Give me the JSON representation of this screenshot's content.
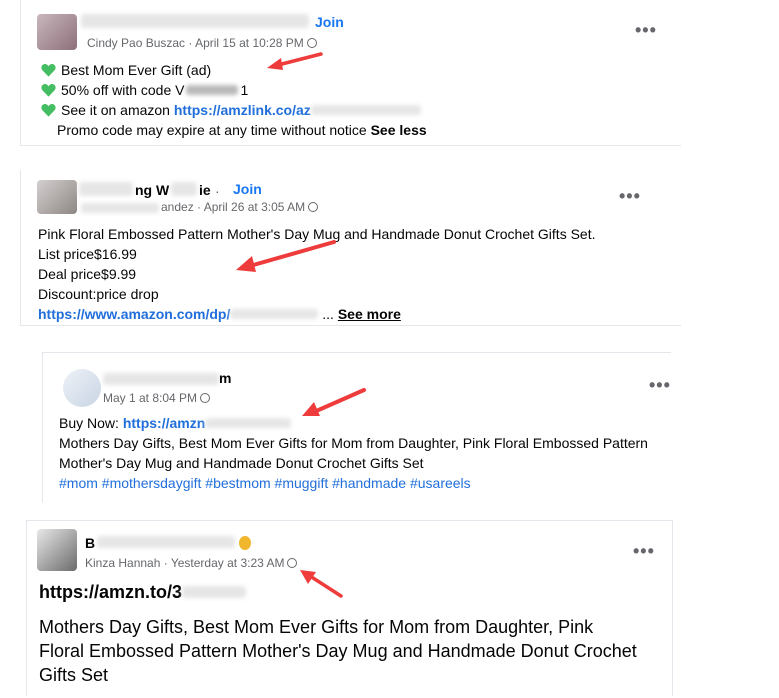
{
  "post1": {
    "join": "Join",
    "author": "Cindy Pao Buszac",
    "time": "April 15 at 10:28 PM",
    "line1": "Best Mom Ever Gift  (ad)",
    "line2": "50% off with code V",
    "line2_tail": "1",
    "line3_prefix": "See it on amazon",
    "line3_link": "https://amzlink.co/az",
    "line4": "Promo code may expire at any time without notice",
    "see_less": "See less"
  },
  "post2": {
    "group_partial": "ng W",
    "group_tail": "ie",
    "join": "Join",
    "author_partial": "andez",
    "time": "April 26 at 3:05 AM",
    "line1": "Pink Floral Embossed Pattern Mother's Day Mug and Handmade Donut Crochet Gifts Set.",
    "line2": "List price$16.99",
    "line3": "Deal price$9.99",
    "line4": "Discount:price drop",
    "link": "https://www.amazon.com/dp/",
    "ellipsis": "...",
    "see_more": "See more"
  },
  "post3": {
    "name_partial": "m",
    "time": "May 1 at 8:04 PM",
    "buy_prefix": "Buy Now:",
    "buy_link": "https://amzn",
    "line2": "Mothers Day Gifts, Best Mom Ever Gifts for Mom from Daughter, Pink Floral Embossed Pattern",
    "line3": "Mother's Day Mug and Handmade Donut Crochet Gifts Set",
    "hashtags": "#mom #mothersdaygift #bestmom #muggift #handmade #usareels"
  },
  "post4": {
    "name_partial": "B",
    "author": "Kinza Hannah",
    "time": "Yesterday at 3:23 AM",
    "link": "https://amzn.to/3",
    "text": "Mothers Day Gifts, Best Mom Ever Gifts for Mom from Daughter, Pink Floral Embossed Pattern Mother's Day Mug and Handmade Donut Crochet Gifts Set"
  },
  "ui": {
    "more_dots": "•••",
    "separator": " · "
  },
  "colors": {
    "link": "#216fdb",
    "join": "#1877f2",
    "arrow": "#ee3b3b",
    "heart": "#45bd62",
    "meta": "#65676b"
  }
}
